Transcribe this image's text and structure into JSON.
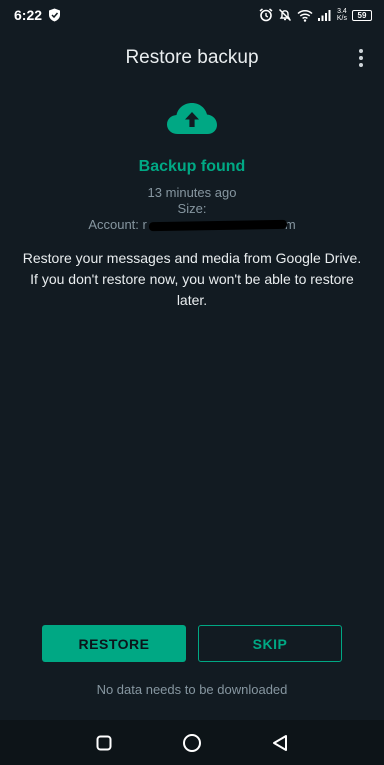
{
  "status_bar": {
    "time": "6:22",
    "net_speed_value": "3.4",
    "net_speed_unit": "K/s",
    "battery": "59",
    "icons": [
      "shield-icon",
      "alarm-icon",
      "mute-icon",
      "wifi-icon",
      "signal-icon",
      "battery-icon"
    ]
  },
  "app_bar": {
    "title": "Restore backup",
    "menu_icon": "more-vert-icon"
  },
  "backup": {
    "icon": "cloud-upload-icon",
    "title": "Backup found",
    "time_ago": "13 minutes ago",
    "size_label": "Size:",
    "account_label": "Account: r",
    "account_suffix": "m"
  },
  "description": "Restore your messages and media from Google Drive. If you don't restore now, you won't be able to restore later.",
  "buttons": {
    "restore": "RESTORE",
    "skip": "SKIP"
  },
  "footnote": "No data needs to be downloaded",
  "nav_bar": {
    "icons": [
      "recents-icon",
      "home-icon",
      "back-icon"
    ]
  },
  "colors": {
    "background": "#121b22",
    "accent": "#00a884",
    "primary_text": "#e9edef",
    "secondary_text": "#8696a0"
  }
}
